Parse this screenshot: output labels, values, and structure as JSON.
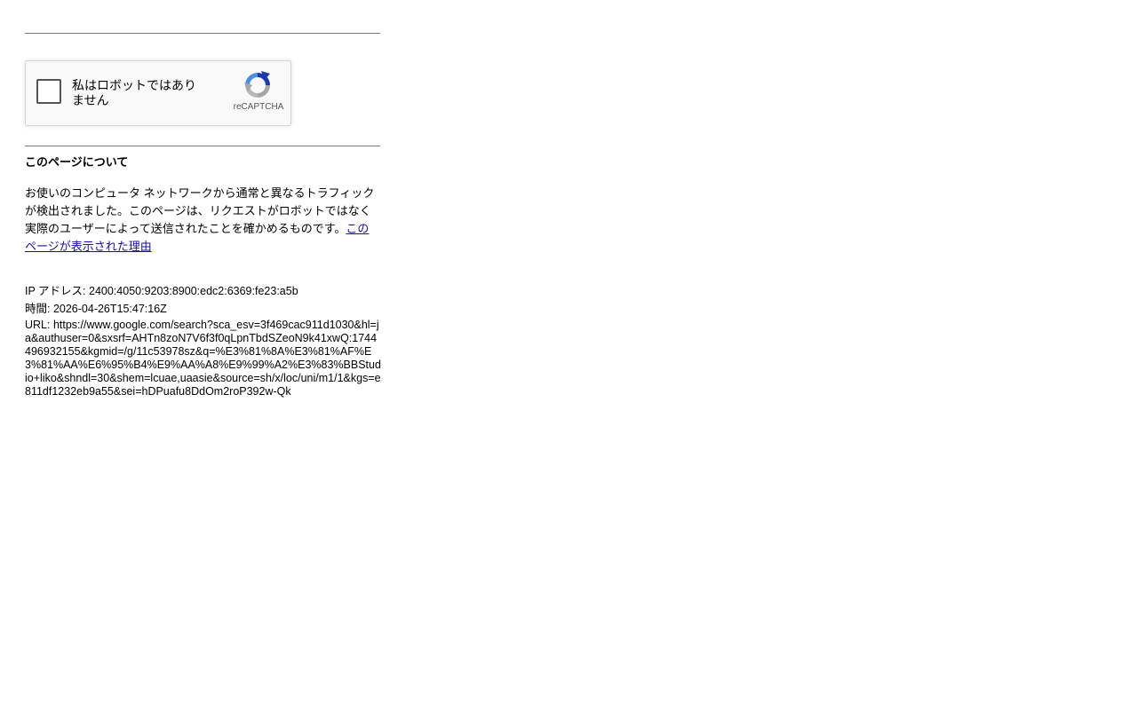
{
  "captcha": {
    "checkbox_label": "私はロボットではありません",
    "brand": "reCAPTCHA"
  },
  "about": {
    "title": "このページについて",
    "body": "お使いのコンピュータ ネットワークから通常と異なるトラフィックが検出されました。このページは、リクエストがロボットではなく実際のユーザーによって送信されたことを確かめるものです。",
    "link_text": "このページが表示された理由"
  },
  "details": {
    "ip": "IP アドレス: 2400:4050:9203:8900:edc2:6369:fe23:a5b",
    "time": "時間: 2026-04-26T15:47:16Z",
    "url": "URL: https://www.google.com/search?sca_esv=3f469cac911d1030&hl=ja&authuser=0&sxsrf=AHTn8zoN7V6f3f0qLpnTbdSZeoN9k41xwQ:1744496932155&kgmid=/g/11c53978sz&q=%E3%81%8A%E3%81%AF%E3%81%AA%E6%95%B4%E9%AA%A8%E9%99%A2%E3%83%BBStudio+liko&shndl=30&shem=lcuae,uaasie&source=sh/x/loc/uni/m1/1&kgs=e811df1232eb9a55&sei=hDPuafu8DdOm2roP392w-Qk"
  },
  "colors": {
    "link": "#1a0dab",
    "rule": "#7a7a7a",
    "captcha_bg": "#f9f9f9"
  }
}
